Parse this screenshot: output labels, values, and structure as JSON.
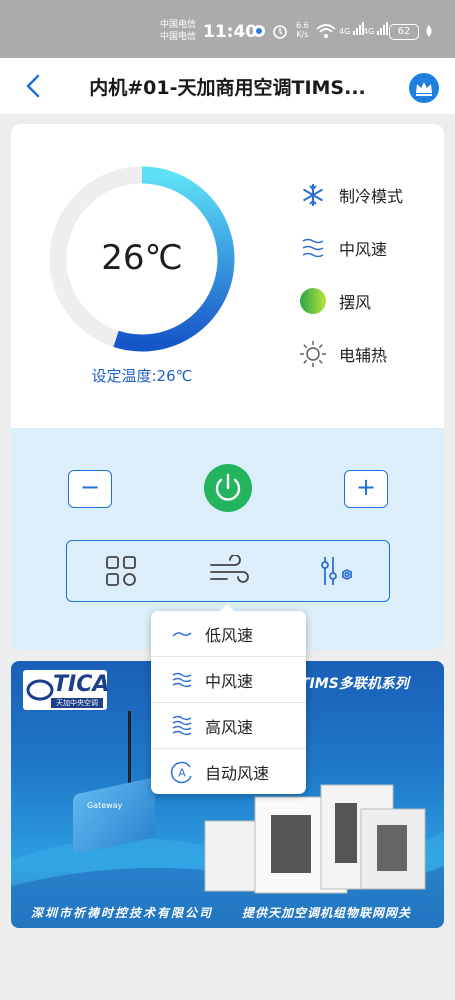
{
  "status_bar": {
    "carrier_1": "中国电信",
    "carrier_2": "中国电信",
    "time": "11:40",
    "speed": "6.6",
    "speed_unit": "K/s",
    "net_1": "4G",
    "net_2": "4G",
    "battery": "62"
  },
  "header": {
    "title": "内机#01-天加商用空调TIMS..."
  },
  "thermostat": {
    "current_temp": "26℃",
    "setpoint_label": "设定温度:26℃",
    "ring_fill_fraction": 0.55
  },
  "status_list": [
    {
      "icon": "snowflake-icon",
      "label": "制冷模式"
    },
    {
      "icon": "fan-speed-icon",
      "label": "中风速"
    },
    {
      "icon": "swing-icon",
      "label": "摆风"
    },
    {
      "icon": "sun-icon",
      "label": "电辅热"
    }
  ],
  "controls": {
    "minus": "−",
    "plus": "+",
    "tools": [
      "mode-grid-icon",
      "wind-icon",
      "settings-sliders-icon"
    ]
  },
  "fan_menu": {
    "options": [
      {
        "icon": "low-wind-icon",
        "label": "低风速"
      },
      {
        "icon": "mid-wind-icon",
        "label": "中风速"
      },
      {
        "icon": "high-wind-icon",
        "label": "高风速"
      },
      {
        "icon": "auto-wind-icon",
        "label": "自动风速"
      }
    ]
  },
  "banner": {
    "brand": "TICA",
    "brand_sub": "天加中央空调",
    "series": "TIMS多联机系列",
    "gateway_label": "Gateway",
    "footer_left": "深圳市祈祷时控技术有限公司",
    "footer_right": "提供天加空调机组物联网网关"
  },
  "colors": {
    "accent": "#1e72d6",
    "power": "#25b45e",
    "control_bg": "#dceef9"
  }
}
